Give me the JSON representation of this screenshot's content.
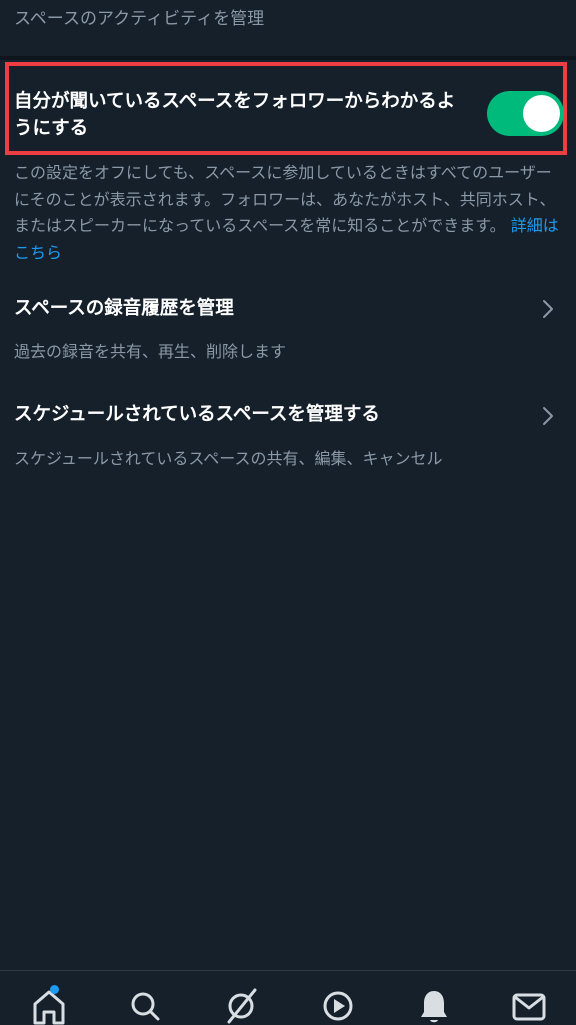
{
  "header": {
    "subtitle": "スペースのアクティビティを管理"
  },
  "toggle_setting": {
    "label": "自分が聞いているスペースをフォロワーからわかるようにする",
    "state": "on",
    "description": "この設定をオフにしても、スペースに参加しているときはすべてのユーザーにそのことが表示されます。フォロワーは、あなたがホスト、共同ホスト、またはスピーカーになっているスペースを常に知ることができます。",
    "link_text": "詳細はこちら"
  },
  "rows": [
    {
      "title": "スペースの録音履歴を管理",
      "subtitle": "過去の録音を共有、再生、削除します"
    },
    {
      "title": "スケジュールされているスペースを管理する",
      "subtitle": "スケジュールされているスペースの共有、編集、キャンセル"
    }
  ],
  "tabbar": {
    "tabs": [
      "home-icon",
      "search-icon",
      "spaces-icon",
      "video-icon",
      "notifications-icon",
      "messages-icon"
    ]
  },
  "colors": {
    "background": "#15202b",
    "accent": "#1d9bf0",
    "toggle_on": "#00ba7c",
    "highlight_border": "#ef3e43",
    "secondary_text": "#8b98a5"
  }
}
